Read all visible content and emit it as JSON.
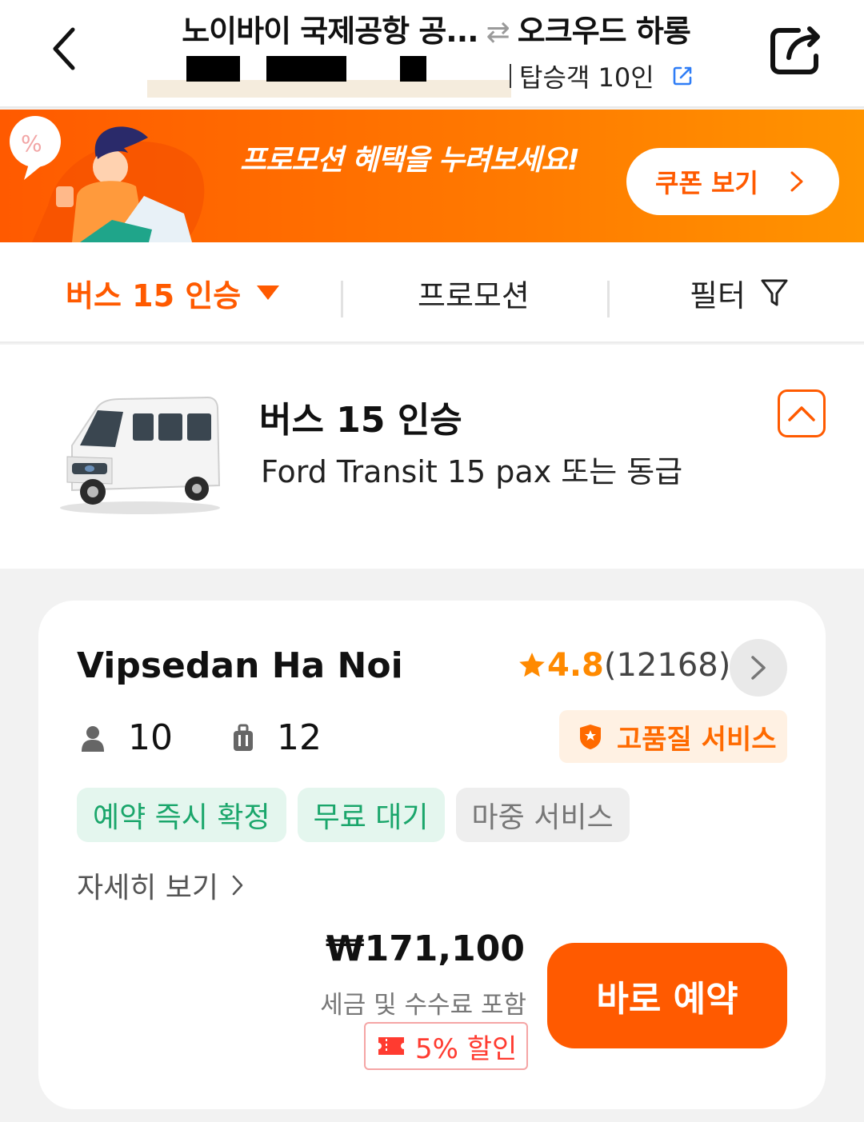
{
  "header": {
    "origin": "노이바이 국제공항 공...",
    "swap_symbol": "⇄",
    "destination": "오크우드 하롱",
    "passengers": "탑승객 10인"
  },
  "banner": {
    "text": "프로모션 혜택을 누려보세요!",
    "coupon_button": "쿠폰 보기"
  },
  "filterbar": {
    "vehicle": "버스 15 인승",
    "promotion": "프로모션",
    "filter": "필터"
  },
  "vehicle": {
    "name": "버스 15 인승",
    "model": "Ford Transit 15 pax 또는 동급"
  },
  "offer": {
    "operator": "Vipsedan Ha Noi",
    "rating": "4.8",
    "review_count": "(12168)",
    "passenger_capacity": "10",
    "luggage_capacity": "12",
    "quality_badge": "고품질 서비스",
    "tags": [
      "예약 즉시 확정",
      "무료 대기",
      "마중 서비스"
    ],
    "details_link": "자세히 보기",
    "price": "₩171,100",
    "tax_note": "세금 및 수수료 포함",
    "discount": "5% 할인",
    "book_button": "바로 예약"
  },
  "colors": {
    "accent": "#ff5a00",
    "rating_star": "#ff8a00",
    "tag_green": "#1aa66b",
    "discount_red": "#ff3b30"
  }
}
